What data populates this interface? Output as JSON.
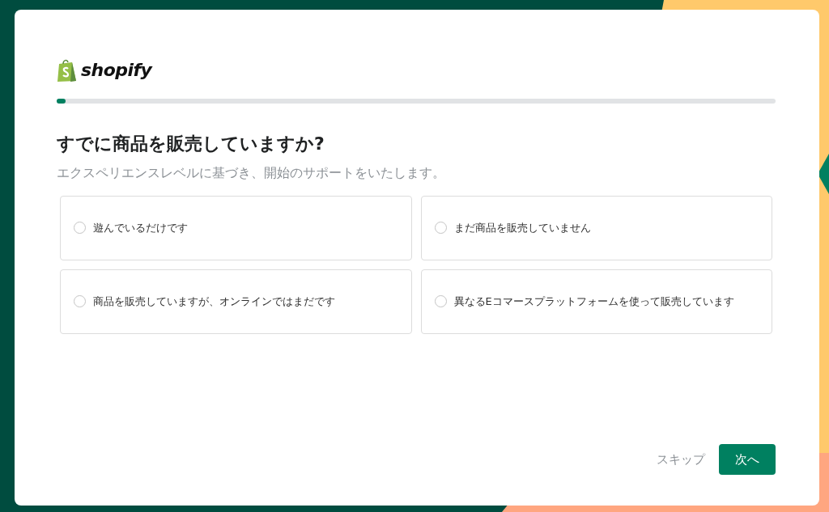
{
  "logo": {
    "text": "shopify"
  },
  "progress": {
    "level": 0.012
  },
  "title": "すでに商品を販売していますか?",
  "subtitle": "エクスペリエンスレベルに基づき、開始のサポートをいたします。",
  "options": [
    {
      "label": "遊んでいるだけです",
      "selected": false
    },
    {
      "label": "まだ商品を販売していません",
      "selected": false
    },
    {
      "label": "商品を販売していますが、オンラインではまだです",
      "selected": false
    },
    {
      "label": "異なるEコマースプラットフォームを使って販売しています",
      "selected": false
    }
  ],
  "actions": {
    "skip": "スキップ",
    "next": "次へ"
  }
}
